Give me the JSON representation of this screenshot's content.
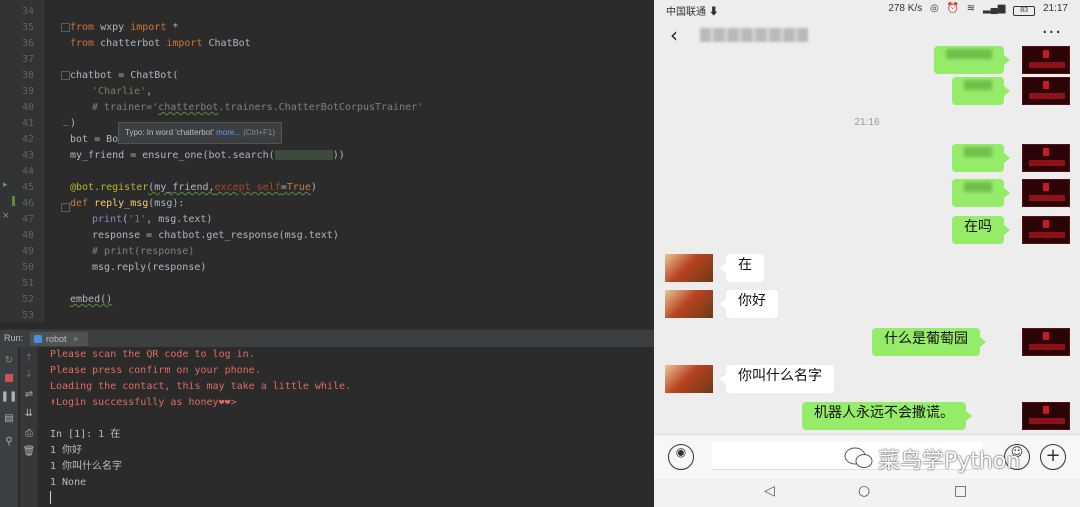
{
  "ide": {
    "gutter_lines": [
      "34",
      "35",
      "36",
      "37",
      "38",
      "39",
      "40",
      "41",
      "42",
      "43",
      "44",
      "45",
      "46",
      "47",
      "48",
      "49",
      "50",
      "51",
      "52",
      "53"
    ],
    "code": {
      "l35": [
        "from",
        " wxpy ",
        "import",
        " *"
      ],
      "l36": [
        "from",
        " chatterbot ",
        "import",
        " ChatBot"
      ],
      "l38": "chatbot = ChatBot(",
      "l39": "'Charlie'",
      "l40_a": "# trainer='",
      "l40_b": "chatterbot",
      "l40_c": ".trainers.ChatterBotCorpusTrainer'",
      "l41": ")",
      "l42": "bot = Bo",
      "l43_a": "my_friend = ensure_one(bot.search(",
      "l43_b": "))",
      "l45_dec": "@bot.register",
      "l45_args": "(my_friend,",
      "l45_kw": "except_self",
      "l45_eq": "=",
      "l45_true": "True",
      "l45_end": ")",
      "l46_def": "def",
      "l46_name": " reply_msg",
      "l46_rest": "(msg):",
      "l47_print": "print",
      "l47_open": "(",
      "l47_str": "'1'",
      "l47_rest": ", msg.text)",
      "l48": "response = chatbot.get_response(msg.text)",
      "l49": "# print(response)",
      "l50": "msg.reply(response)",
      "l52": "embed()"
    },
    "tooltip": {
      "text": "Typo: In word 'chatterbot'",
      "link": "more...",
      "shortcut": "(Ctrl+F1)"
    },
    "run_label": "Run:",
    "run_tab": "robot",
    "console": [
      {
        "text": "Please scan the QR code to log in.",
        "err": true
      },
      {
        "text": "Please press confirm on your phone.",
        "err": true
      },
      {
        "text": "Loading the contact, this may take a little while.",
        "err": true
      },
      {
        "text": "⬆Login successfully as honey❤❤>",
        "err": true
      },
      {
        "text": "",
        "err": false
      },
      {
        "text": "In [1]: 1 在",
        "err": false
      },
      {
        "text": "1 你好",
        "err": false
      },
      {
        "text": "1 你叫什么名字",
        "err": false
      },
      {
        "text": "1 None",
        "err": false
      }
    ]
  },
  "phone": {
    "status": {
      "carrier": "中国联通 ⬇",
      "speed": "278 K/s",
      "time": "21:17",
      "battery": "83"
    },
    "header": {
      "back": "‹",
      "more": "···"
    },
    "time_separator": "21:16",
    "messages": [
      {
        "from": "me",
        "text": "",
        "blurred": true
      },
      {
        "from": "me",
        "text": "",
        "blurred": true
      },
      {
        "from": "me",
        "text": "",
        "blurred": true
      },
      {
        "from": "me",
        "text": "",
        "blurred": true
      },
      {
        "from": "me",
        "text": "在吗",
        "blurred": false
      },
      {
        "from": "bot",
        "text": "在",
        "blurred": false
      },
      {
        "from": "bot",
        "text": "你好",
        "blurred": false
      },
      {
        "from": "me",
        "text": "什么是葡萄园",
        "blurred": false
      },
      {
        "from": "bot",
        "text": "你叫什么名字",
        "blurred": false
      },
      {
        "from": "me",
        "text": "机器人永远不会撒谎。",
        "blurred": false
      }
    ],
    "watermark": "菜鸟学Python",
    "nav": {
      "back": "◁",
      "home": "○",
      "recents": "□"
    }
  }
}
